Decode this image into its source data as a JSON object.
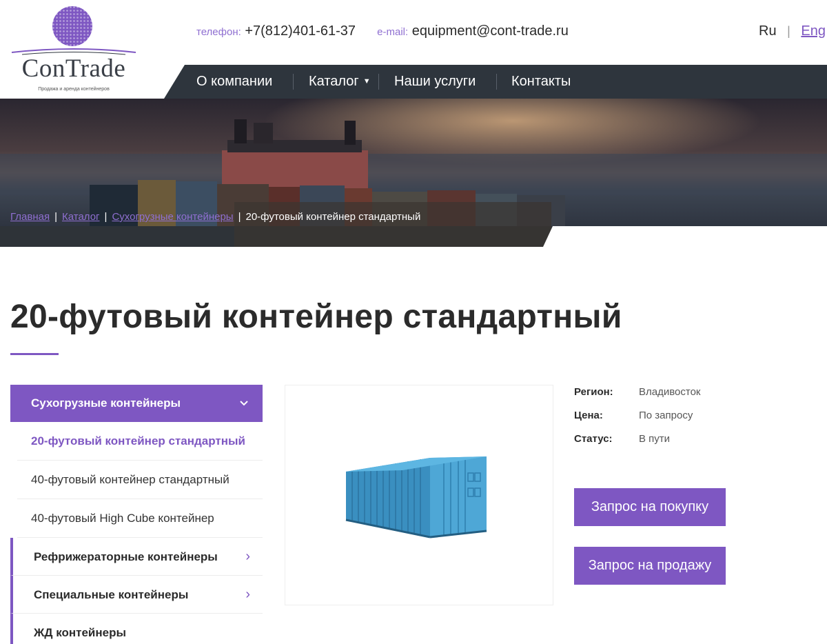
{
  "header": {
    "brand": "ConTrade",
    "tagline": "Продажа и аренда контейнеров",
    "phone_label": "телефон:",
    "phone": "+7(812)401-61-37",
    "email_label": "e-mail:",
    "email": "equipment@cont-trade.ru",
    "lang_ru": "Ru",
    "lang_sep": "|",
    "lang_eng": "Eng"
  },
  "nav": {
    "items": [
      {
        "label": "О компании"
      },
      {
        "label": "Каталог",
        "icon": "caret-down-icon"
      },
      {
        "label": "Наши услуги"
      },
      {
        "label": "Контакты"
      }
    ]
  },
  "breadcrumb": {
    "items": [
      "Главная",
      "Каталог",
      "Сухогрузные контейнеры"
    ],
    "current": "20-футовый контейнер стандартный"
  },
  "page": {
    "title": "20-футовый контейнер стандартный"
  },
  "sidebar": {
    "active_category": "Сухогрузные контейнеры",
    "subitems": [
      {
        "label": "20-футовый контейнер стандартный",
        "current": true
      },
      {
        "label": "40-футовый контейнер стандартный",
        "current": false
      },
      {
        "label": "40-футовый High Cube контейнер",
        "current": false
      }
    ],
    "categories": [
      {
        "label": "Рефрижераторные контейнеры",
        "icon": "chevron-right-icon"
      },
      {
        "label": "Специальные контейнеры",
        "icon": "chevron-right-icon"
      },
      {
        "label": "ЖД контейнеры"
      }
    ]
  },
  "specs": {
    "region_label": "Регион:",
    "region": "Владивосток",
    "price_label": "Цена:",
    "price": "По запросу",
    "status_label": "Статус:",
    "status": "В пути"
  },
  "actions": {
    "buy": "Запрос на покупку",
    "sell": "Запрос на продажу"
  },
  "colors": {
    "accent": "#7e57c2",
    "nav_bg": "#2e353d",
    "text": "#2b2b2b"
  }
}
